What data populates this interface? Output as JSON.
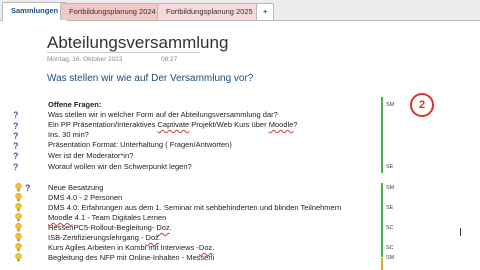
{
  "tabs": {
    "tab1": "Sammlungen",
    "tab2": "Fortbildungsplanung 2024",
    "tab3": "Fortbildungsplanung 2025",
    "add": "+"
  },
  "page": {
    "title": "Abteilungsversammlung",
    "date": "Montag, 16. Oktober 2023",
    "time": "08:27",
    "heading": "Was stellen wir wie auf Der Versammlung vor?"
  },
  "badge": "2",
  "lines": [
    {
      "text": "Offene Fragen:",
      "tag": "SM"
    },
    {
      "text": "Was stellen wir in welcher Form auf der Abteilungsversammlung dar?"
    },
    {
      "pre": "Ein PP Präsentation/Interaktives ",
      "sq1": "Captivate",
      "mid": " Projekt/Web Kurs über ",
      "sq2": "Moodle",
      "post": "?"
    },
    {
      "text": "Ins. 30 min?"
    },
    {
      "text": "Präsentation Format: Unterhaltung ( Fragen/Antworten)"
    },
    {
      "text": "Wer ist der Moderator*in?"
    },
    {
      "text": "Worauf wollen wir den Schwerpunkt legen?",
      "tag": "SE"
    },
    {
      "text": "Neue Besatzung",
      "tag": "SM"
    },
    {
      "text": "DMS 4.0 - 2 Personen"
    },
    {
      "text": "DMS 4.0: Erfahrungen aus dem 1. Seminar mit sehbehinderten und blinden Teilnehmern",
      "tag": "SE"
    },
    {
      "sq": "Moodle",
      "post": " 4.1 - Team Digitales Lernen"
    },
    {
      "pre": "HessenPC5-Rollout-Begleitung- ",
      "sq": "Doz",
      "post": ".",
      "tag": "SC"
    },
    {
      "pre": "ISB-Zertifizierungslehrgang - ",
      "sq": "Doz",
      "post": "."
    },
    {
      "pre": "Kurs Agiles Arbeiten in Kombi mit Interviews -",
      "sq": "Doz",
      "post": ".",
      "tag": "SC"
    },
    {
      "text": "Begleitung des NFP mit Online-Inhalten - Messerli",
      "tag": "SM"
    }
  ],
  "marker": {
    "question": "?"
  },
  "colors": {
    "accent_red": "#d9352b",
    "tag_bar_green": "#4caf50",
    "question_purple": "#7a3ca6",
    "bulb_yellow": "#f2c230"
  }
}
